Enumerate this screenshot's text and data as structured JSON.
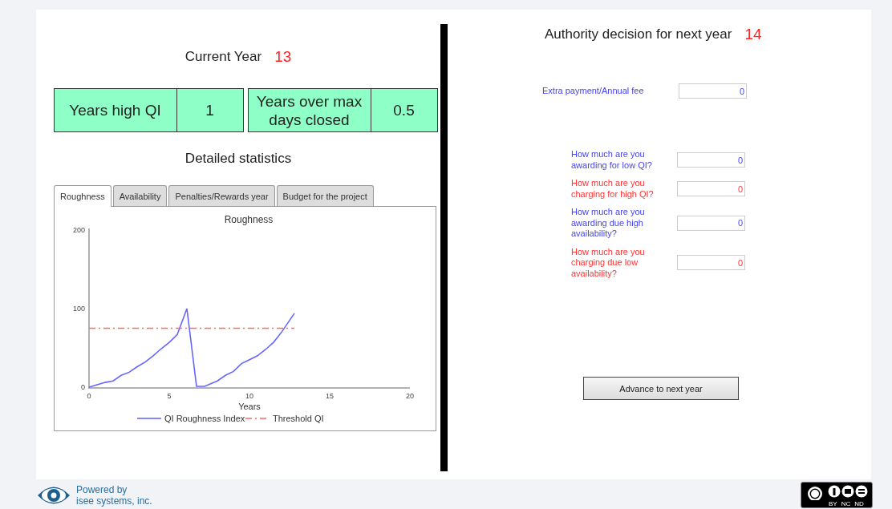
{
  "current_year": {
    "label": "Current Year",
    "value": "13"
  },
  "stats": [
    {
      "label": "Years high QI",
      "value": "1"
    },
    {
      "label": "Years over max days closed",
      "value": "0.5"
    }
  ],
  "detail_title": "Detailed statistics",
  "tabs": [
    {
      "label": "Roughness",
      "selected": true
    },
    {
      "label": "Availability",
      "selected": false
    },
    {
      "label": "Penalties/Rewards year",
      "selected": false
    },
    {
      "label": "Budget for the project",
      "selected": false
    }
  ],
  "chart_data": {
    "type": "line",
    "title": "Roughness",
    "xlabel": "Years",
    "xlim": [
      0,
      20
    ],
    "ylim": [
      0,
      200
    ],
    "xticks": [
      0,
      5,
      10,
      15,
      20
    ],
    "yticks": [
      0,
      100,
      200
    ],
    "x": [
      0,
      0.5,
      1,
      1.5,
      2,
      2.5,
      3,
      3.5,
      4,
      4.5,
      5,
      5.5,
      6.1,
      6.7,
      7.2,
      8,
      8.5,
      9,
      9.5,
      10,
      10.5,
      11,
      11.5,
      12,
      12.8
    ],
    "legend": true,
    "series": [
      {
        "name": "QI Roughness Index",
        "color": "#6666ff",
        "line_style": "solid",
        "values": [
          0,
          3,
          6,
          8,
          15,
          19,
          26,
          32,
          40,
          49,
          57,
          67,
          100,
          1,
          1,
          8,
          15,
          20,
          30,
          35,
          40,
          48,
          57,
          70,
          94
        ]
      },
      {
        "name": "Threshold QI",
        "color": "#ff6666",
        "line_style": "dashdot",
        "values": [
          75,
          75,
          75,
          75,
          75,
          75,
          75,
          75,
          75,
          75,
          75,
          75,
          75,
          75,
          75,
          75,
          75,
          75,
          75,
          75,
          75,
          75,
          75,
          75,
          75
        ]
      }
    ]
  },
  "decision": {
    "label": "Authority decision for next year",
    "value": "14"
  },
  "fee_field": {
    "label": "Extra payment/Annual fee",
    "value": "0",
    "color": "#4444ee"
  },
  "question_fields": [
    {
      "label": "How much are you awarding for low QI?",
      "value": "0",
      "color": "#4444ee"
    },
    {
      "label": "How much are you charging for high QI?",
      "value": "0",
      "color": "#ff3333"
    },
    {
      "label": "How much are you awarding due high availability?",
      "value": "0",
      "color": "#4444ee"
    },
    {
      "label": "How much are you charging due low availability?",
      "value": "0",
      "color": "#ff3333"
    }
  ],
  "advance_button": "Advance to next year",
  "footer": {
    "powered_by": [
      "Powered by",
      "isee systems, inc."
    ],
    "license_labels": [
      "BY",
      "NC",
      "ND"
    ]
  }
}
